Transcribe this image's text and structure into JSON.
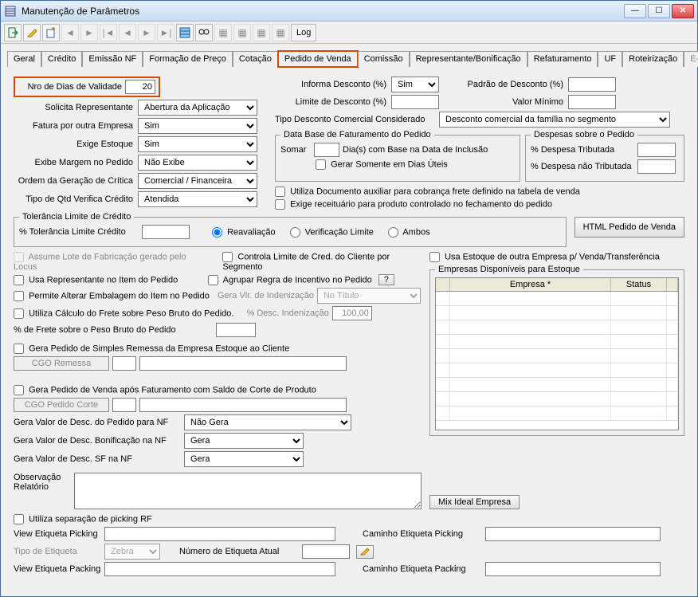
{
  "window": {
    "title": "Manutenção de Parâmetros"
  },
  "toolbar": {
    "log": "Log"
  },
  "tabs": [
    {
      "label": "Geral"
    },
    {
      "label": "Crédito"
    },
    {
      "label": "Emissão NF"
    },
    {
      "label": "Formação de Preço"
    },
    {
      "label": "Cotação"
    },
    {
      "label": "Pedido de Venda"
    },
    {
      "label": "Comissão"
    },
    {
      "label": "Representante/Bonificação"
    },
    {
      "label": "Refaturamento"
    },
    {
      "label": "UF"
    },
    {
      "label": "Roteirização"
    },
    {
      "label": "E-commerce"
    }
  ],
  "left": {
    "nro_dias_validade_label": "Nro de Dias de Validade",
    "nro_dias_validade_value": "20",
    "solicita_representante_label": "Solicita Representante",
    "solicita_representante_value": "Abertura da Aplicação",
    "fatura_outra_empresa_label": "Fatura por outra Empresa",
    "fatura_outra_empresa_value": "Sim",
    "exige_estoque_label": "Exige Estoque",
    "exige_estoque_value": "Sim",
    "exibe_margem_label": "Exibe Margem no Pedido",
    "exibe_margem_value": "Não Exibe",
    "ordem_geracao_label": "Ordem da Geração de Crítica",
    "ordem_geracao_value": "Comercial / Financeira",
    "tipo_qtd_label": "Tipo de Qtd Verifica Crédito",
    "tipo_qtd_value": "Atendida"
  },
  "right_top": {
    "informa_desc_label": "Informa Desconto (%)",
    "informa_desc_value": "Sim",
    "limite_desc_label": "Limite de Desconto (%)",
    "padrao_desc_label": "Padrão de Desconto (%)",
    "valor_minimo_label": "Valor Mínimo",
    "tipo_desc_considerado_label": "Tipo Desconto Comercial Considerado",
    "tipo_desc_considerado_value": "Desconto comercial da família no segmento"
  },
  "databasefat": {
    "legend": "Data Base de Faturamento do Pedido",
    "somar_label": "Somar",
    "dias_label": "Dia(s)  com Base na Data de Inclusão",
    "gerar_dias_uteis": "Gerar Somente em Dias Úteis"
  },
  "despesas": {
    "legend": "Despesas sobre o Pedido",
    "tributada_label": "% Despesa Tributada",
    "nao_tributada_label": "% Despesa não Tributada"
  },
  "mid_checks": {
    "utiliza_doc_aux": "Utiliza Documento auxiliar para cobrança frete definido na tabela de venda",
    "exige_receituario": "Exige receituário para produto controlado no fechamento do pedido"
  },
  "tolerancia": {
    "legend": "Tolerância Limite de Crédito",
    "pct_label": "% Tolerância Limite Crédito",
    "reavaliacao": "Reavaliação",
    "verificacao": "Verificação Limite",
    "ambos": "Ambos"
  },
  "html_btn": "HTML Pedido de Venda",
  "checks": {
    "assume_lote": "Assume Lote de Fabricação gerado pelo Locus",
    "usa_repr_item": "Usa Representante no Item do Pedido",
    "permite_alterar_emb": "Permite Alterar Embalagem do Item no Pedido",
    "utiliza_calc_frete": "Utiliza Cálculo do Frete sobre Peso Bruto do Pedido.",
    "pct_frete_label": "% de Frete sobre o Peso Bruto do Pedido",
    "controla_limite_cred": "Controla Limite de Cred. do Cliente por Segmento",
    "agrupar_regra": "Agrupar Regra de Incentivo no Pedido",
    "gera_vlr_indeniz_label": "Gera Vlr. de Indenização",
    "gera_vlr_indeniz_value": "No Título",
    "pct_desc_indeniz_label": "% Desc. Indenização",
    "pct_desc_indeniz_value": "100,00",
    "usa_estoque_outra": "Usa Estoque de outra Empresa p/ Venda/Transferência",
    "q_btn": "?"
  },
  "empresas": {
    "legend": "Empresas Disponíveis para Estoque",
    "col_empresa": "Empresa *",
    "col_status": "Status"
  },
  "remessa": {
    "gera_simples_remessa": "Gera Pedido de Simples Remessa da Empresa Estoque ao Cliente",
    "cgo_remessa_btn": "CGO Remessa"
  },
  "corte": {
    "gera_pedido_venda_corte": "Gera Pedido de Venda após Faturamento com Saldo de Corte de Produto",
    "cgo_corte_btn": "CGO Pedido Corte",
    "gera_valor_desc_nf_label": "Gera Valor de Desc. do Pedido para NF",
    "gera_valor_desc_nf_value": "Não Gera",
    "gera_valor_desc_bonif_label": "Gera Valor de Desc. Bonificação na NF",
    "gera_valor_desc_bonif_value": "Gera",
    "gera_valor_desc_sf_label": "Gera Valor de Desc. SF na NF",
    "gera_valor_desc_sf_value": "Gera"
  },
  "obs": {
    "label": "Observação Relatório"
  },
  "mix_btn": "Mix Ideal Empresa",
  "picking": {
    "utiliza_sep": "Utiliza separação de picking RF",
    "view_etq_picking_label": "View Etiqueta Picking",
    "tipo_etiqueta_label": "Tipo de Etiqueta",
    "tipo_etiqueta_value": "Zebra",
    "numero_etq_label": "Número de Etiqueta Atual",
    "view_etq_packing_label": "View Etiqueta Packing",
    "caminho_etq_picking_label": "Caminho Etiqueta Picking",
    "caminho_etq_packing_label": "Caminho Etiqueta Packing"
  }
}
